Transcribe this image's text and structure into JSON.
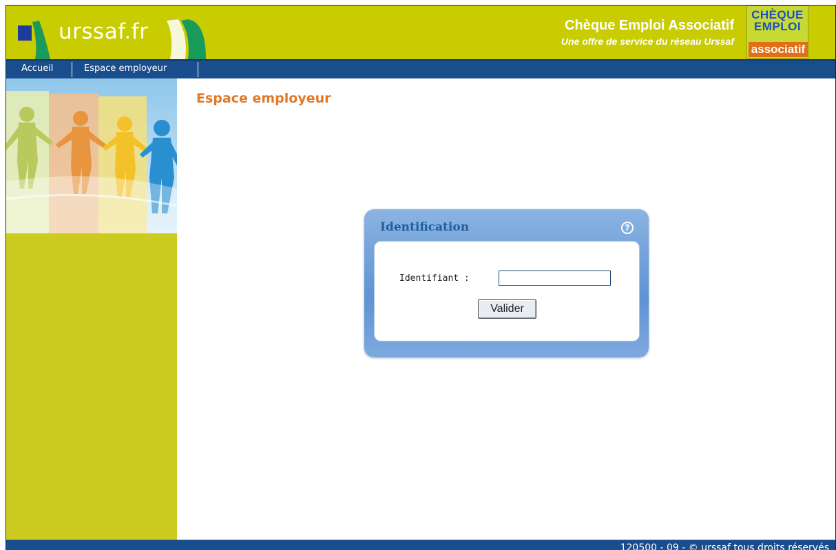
{
  "header": {
    "site_logo_text": "urssaf.fr",
    "title": "Chèque Emploi Associatif",
    "subtitle": "Une offre de service du réseau Urssaf",
    "brand_logo": {
      "line1": "CHÈQUE",
      "line2": "EMPLOI",
      "line3": "associatif"
    }
  },
  "nav": {
    "items": [
      {
        "label": "Accueil"
      },
      {
        "label": "Espace employeur"
      }
    ]
  },
  "main": {
    "page_title": "Espace employeur",
    "identification": {
      "title": "Identification",
      "help_icon": "help-icon",
      "field_label": "Identifiant :",
      "field_value": "",
      "submit_label": "Valider"
    }
  },
  "footer": {
    "text": "120500 - 09 - © urssaf tous droits réservés"
  },
  "colors": {
    "header_bg": "#c9cc00",
    "nav_bg": "#1a4d8c",
    "sidebar_bg": "#cccc20",
    "title_orange": "#e07a2a",
    "box_blue": "#5f93d3"
  }
}
